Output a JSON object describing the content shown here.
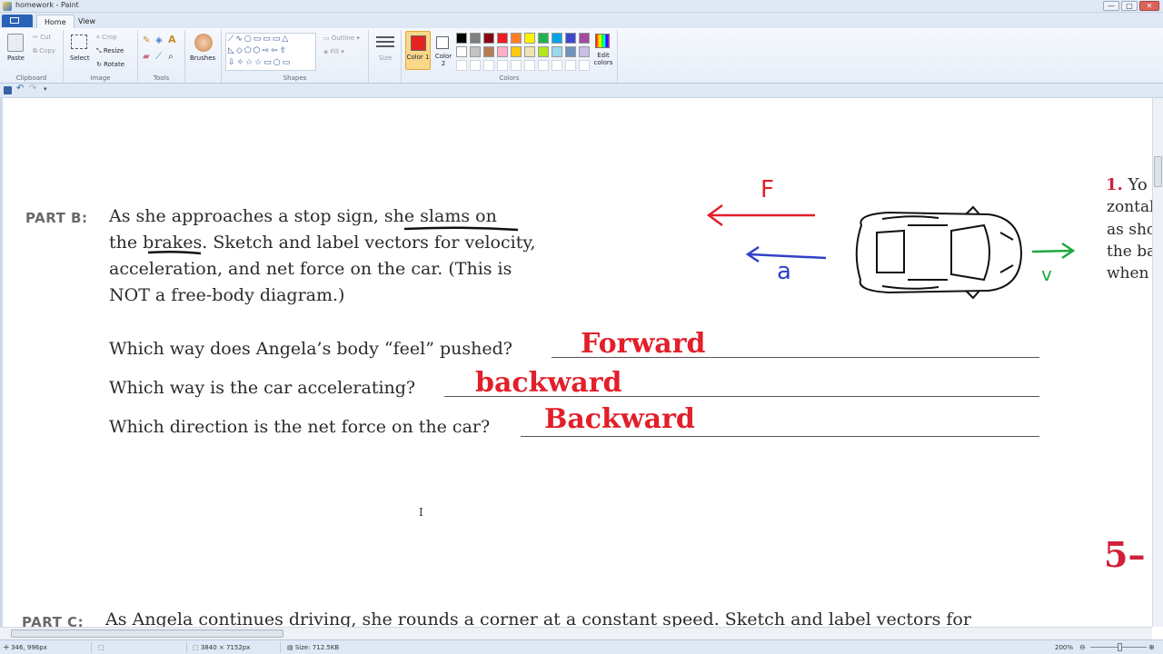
{
  "window": {
    "title": "homework - Paint",
    "min": "—",
    "max": "□",
    "close": "✕"
  },
  "tabs": {
    "home": "Home",
    "view": "View"
  },
  "ribbon": {
    "clipboard": {
      "label": "Clipboard",
      "paste": "Paste",
      "cut": "Cut",
      "copy": "Copy"
    },
    "image": {
      "label": "Image",
      "select": "Select",
      "crop": "Crop",
      "resize": "Resize",
      "rotate": "Rotate"
    },
    "tools": {
      "label": "Tools"
    },
    "brushes": {
      "label": "Brushes"
    },
    "shapes": {
      "label": "Shapes",
      "outline": "Outline",
      "fill": "Fill"
    },
    "size": {
      "label": "Size"
    },
    "colors": {
      "label": "Colors",
      "color1": "Color 1",
      "color2": "Color 2",
      "edit": "Edit colors",
      "color1_value": "#e8231f",
      "color2_value": "#ffffff",
      "palette_row1": [
        "#000000",
        "#7f7f7f",
        "#880015",
        "#ed1c24",
        "#ff7f27",
        "#fff200",
        "#22b14c",
        "#00a2e8",
        "#3f48cc",
        "#a349a4"
      ],
      "palette_row2": [
        "#ffffff",
        "#c3c3c3",
        "#b97a57",
        "#ffaec9",
        "#ffc90e",
        "#efe4b0",
        "#b5e61d",
        "#99d9ea",
        "#7092be",
        "#c8bfe7"
      ]
    }
  },
  "document": {
    "partB": {
      "label": "PART B:",
      "lines": [
        "As she approaches a stop sign, she slams on",
        "the brakes. Sketch and label vectors for velocity,",
        "acceleration, and net force on the car. (This is",
        "NOT a free-body diagram.)"
      ]
    },
    "questions": [
      {
        "q": "Which way does Angela’s body “feel” pushed?",
        "a": "Forward"
      },
      {
        "q": "Which way is the car accelerating?",
        "a": "backward"
      },
      {
        "q": "Which direction is the net force on the car?",
        "a": "Backward"
      }
    ],
    "diagram": {
      "force_label": "F",
      "accel_label": "a",
      "velocity_label": "v"
    },
    "right_column": {
      "number": "1.",
      "lines": [
        "Yo",
        "zontal",
        "as sho",
        "the ba",
        "when"
      ],
      "page_marker": "5–"
    },
    "partC": {
      "label": "PART C:",
      "text": "As Angela continues driving, she rounds a corner at a constant speed. Sketch and label vectors for"
    }
  },
  "status": {
    "cursor": "346, 996px",
    "dimensions": "3840 × 7152px",
    "size": "Size: 712.5KB",
    "zoom": "200%"
  }
}
